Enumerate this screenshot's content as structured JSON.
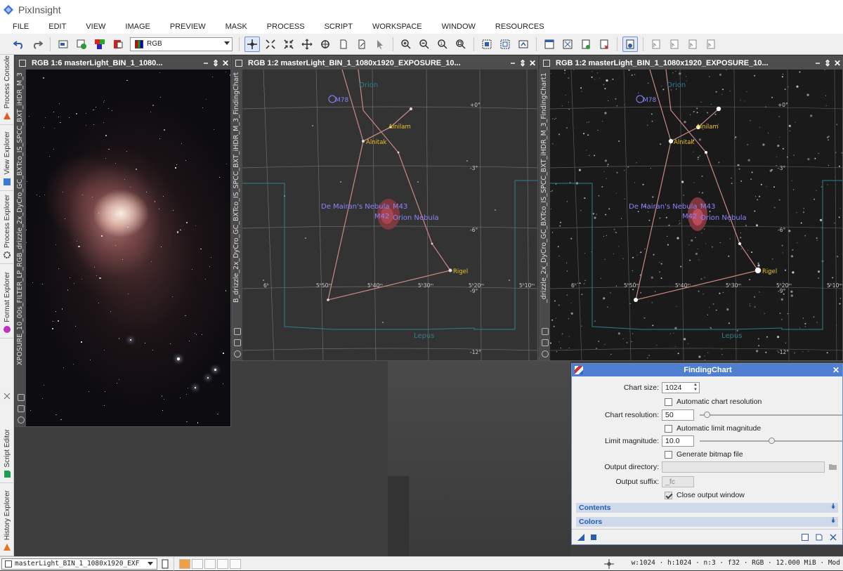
{
  "app": {
    "name": "PixInsight"
  },
  "menu": [
    "FILE",
    "EDIT",
    "VIEW",
    "IMAGE",
    "PREVIEW",
    "MASK",
    "PROCESS",
    "SCRIPT",
    "WORKSPACE",
    "WINDOW",
    "RESOURCES"
  ],
  "toolbar": {
    "channel_select": "RGB"
  },
  "dock_tabs": [
    "Process Console",
    "View Explorer",
    "Process Explorer",
    "Format Explorer",
    "Script Editor",
    "History Explorer"
  ],
  "windows": {
    "photo": {
      "title": "RGB 1:6 masterLight_BIN_1_1080...",
      "side_label": "XPOSURE_10_00s_FILTER_LP_RGB_drizzle_2x_DyCro_GC_BXTco_IS_SPCC_BXT_iHDR_M_3"
    },
    "chart1": {
      "title": "RGB 1:2 masterLight_BIN_1_1080x1920_EXPOSURE_10...",
      "side_label": "B_drizzle_2x_DyCro_GC_BXTco_IS_SPCC_BXT_iHDR_M_3_FindingChart"
    },
    "chart2": {
      "title": "RGB 1:2 masterLight_BIN_1_1080x1920_EXPOSURE_10...",
      "side_label": "_drizzle_2x_DyCro_GC_BXTco_IS_SPCC_BXT_iHDR_M_3_FindingChart1"
    }
  },
  "chart_labels": {
    "constellation_top": "Orion",
    "constellation_bottom": "Lepus",
    "m78": "M78",
    "alnilam": "Alnilam",
    "alnitak": "Alnitak",
    "de_mairan": "De Mairan's Nebula",
    "m43": "M43",
    "m42": "M42",
    "orion_nebula": "Orion Nebula",
    "rigel": "Rigel",
    "dec_0": "+0°",
    "dec_3": "-3°",
    "dec_6": "-6°",
    "dec_9": "-9°",
    "dec_12": "-12°",
    "ra_6h": "6ʰ",
    "ra_550": "5ʰ50ᵐ",
    "ra_540": "5ʰ40ᵐ",
    "ra_530": "5ʰ30ᵐ",
    "ra_520": "5ʰ20ᵐ",
    "ra_510": "5ʰ10ᵐ"
  },
  "finding_chart": {
    "title": "FindingChart",
    "chart_size_label": "Chart size:",
    "chart_size": "1024",
    "auto_chart_resolution": "Automatic chart resolution",
    "chart_resolution_label": "Chart resolution:",
    "chart_resolution": "50",
    "chart_resolution_slider_fraction": 0.05,
    "auto_limit_magnitude": "Automatic limit magnitude",
    "limit_magnitude_label": "Limit magnitude:",
    "limit_magnitude": "10.0",
    "limit_magnitude_slider_fraction": 0.5,
    "generate_bitmap": "Generate bitmap file",
    "output_directory_label": "Output directory:",
    "output_directory": "",
    "output_suffix_label": "Output suffix:",
    "output_suffix": "_fc",
    "close_output_window": "Close output window",
    "contents_section": "Contents",
    "colors_section": "Colors"
  },
  "status": {
    "view_name": "masterLight_BIN_1_1080x1920_EXF",
    "info": "w:1024 · h:1024 · n:3 · f32 · RGB · 12.000 MiB · Mod"
  },
  "colors": {
    "chart_lines": "#c98a84",
    "label_yellow": "#f0c020",
    "label_violet": "#8a84ff",
    "label_teal": "#2f7f8a",
    "grid": "#7a7a7a",
    "panel_header": "#4f7fd0"
  }
}
